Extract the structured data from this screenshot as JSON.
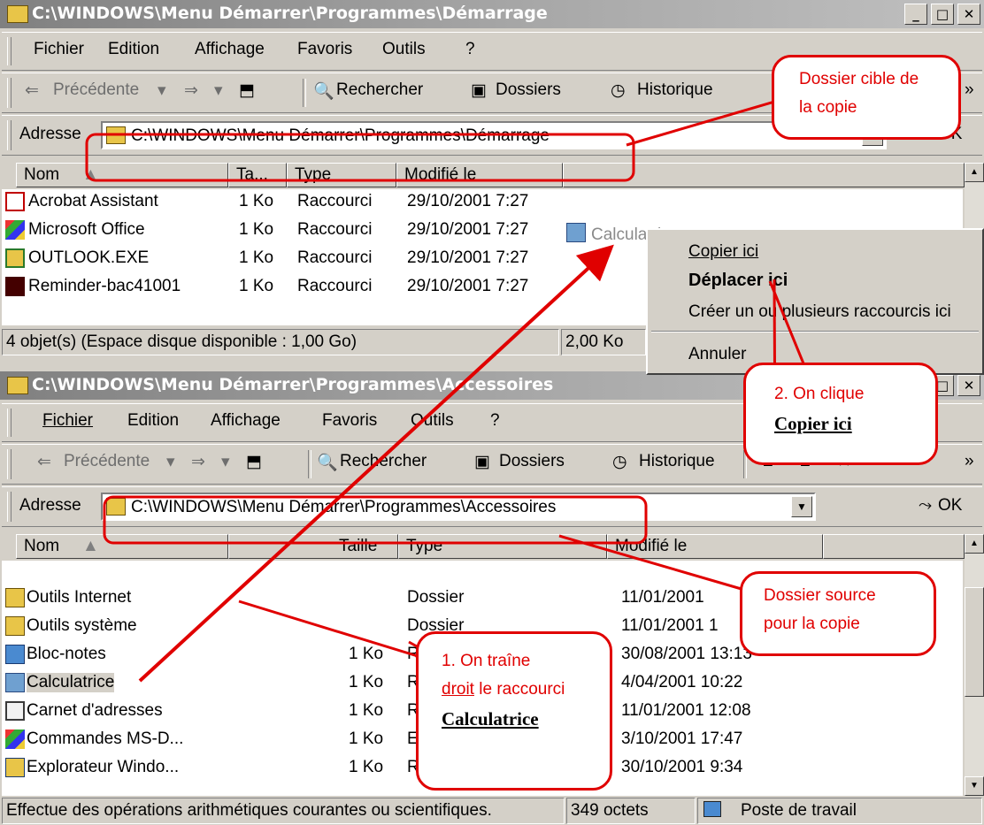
{
  "top_window": {
    "title": "C:\\WINDOWS\\Menu Démarrer\\Programmes\\Démarrage",
    "menu": [
      "Fichier",
      "Edition",
      "Affichage",
      "Favoris",
      "Outils",
      "?"
    ],
    "toolbar": {
      "back": "Précédente",
      "search": "Rechercher",
      "folders": "Dossiers",
      "history": "Historique"
    },
    "address_label": "Adresse",
    "address_value": "C:\\WINDOWS\\Menu Démarrer\\Programmes\\Démarrage",
    "ok_label": "OK",
    "columns": [
      "Nom",
      "Ta...",
      "Type",
      "Modifié le"
    ],
    "rows": [
      {
        "name": "Acrobat Assistant",
        "size": "1 Ko",
        "type": "Raccourci",
        "modified": "29/10/2001 7:27"
      },
      {
        "name": "Microsoft Office",
        "size": "1 Ko",
        "type": "Raccourci",
        "modified": "29/10/2001 7:27"
      },
      {
        "name": "OUTLOOK.EXE",
        "size": "1 Ko",
        "type": "Raccourci",
        "modified": "29/10/2001 7:27"
      },
      {
        "name": "Reminder-bac41001",
        "size": "1 Ko",
        "type": "Raccourci",
        "modified": "29/10/2001 7:27"
      }
    ],
    "dragged_item": "Calculatrice",
    "status_left": "4 objet(s) (Espace disque disponible : 1,00 Go)",
    "status_size": "2,00 Ko"
  },
  "context_menu": {
    "items": [
      "Copier ici",
      "Déplacer ici",
      "Créer un ou plusieurs raccourcis ici",
      "Annuler"
    ]
  },
  "bottom_window": {
    "title": "C:\\WINDOWS\\Menu Démarrer\\Programmes\\Accessoires",
    "menu": [
      "Fichier",
      "Edition",
      "Affichage",
      "Favoris",
      "Outils",
      "?"
    ],
    "toolbar": {
      "back": "Précédente",
      "search": "Rechercher",
      "folders": "Dossiers",
      "history": "Historique"
    },
    "address_label": "Adresse",
    "address_value": "C:\\WINDOWS\\Menu Démarrer\\Programmes\\Accessoires",
    "ok_label": "OK",
    "columns": [
      "Nom",
      "Taille",
      "Type",
      "Modifié le"
    ],
    "rows": [
      {
        "name": "Outils Internet",
        "size": "",
        "type": "Dossier",
        "modified": "11/01/2001"
      },
      {
        "name": "Outils système",
        "size": "",
        "type": "Dossier",
        "modified": "11/01/2001 1"
      },
      {
        "name": "Bloc-notes",
        "size": "1 Ko",
        "type": "Raccourci",
        "modified": "30/08/2001 13:13"
      },
      {
        "name": "Calculatrice",
        "size": "1 Ko",
        "type": "Raccourci",
        "modified": "4/04/2001 10:22"
      },
      {
        "name": "Carnet d'adresses",
        "size": "1 Ko",
        "type": "Raccourci",
        "modified": "11/01/2001 12:08"
      },
      {
        "name": "Commandes MS-D...",
        "size": "1 Ko",
        "type": "Exécutable",
        "modified": "3/10/2001 17:47"
      },
      {
        "name": "Explorateur Windo...",
        "size": "1 Ko",
        "type": "Raccourci",
        "modified": "30/10/2001 9:34"
      }
    ],
    "status_left": "Effectue des opérations arithmétiques courantes ou scientifiques.",
    "status_size": "349 octets",
    "status_zone": "Poste de travail"
  },
  "callouts": {
    "target": {
      "line1": "Dossier cible de",
      "line2": "la copie"
    },
    "click": {
      "line1": "2. On clique",
      "line2": "Copier ici"
    },
    "source": {
      "line1": "Dossier source",
      "line2": "pour la copie"
    },
    "drag": {
      "line1": "1. On traîne",
      "line2a": "droit",
      "line2b": " le raccourci",
      "line3": "Calculatrice"
    }
  },
  "colors": {
    "annotation": "#e00000",
    "chrome": "#d4d0c8"
  }
}
